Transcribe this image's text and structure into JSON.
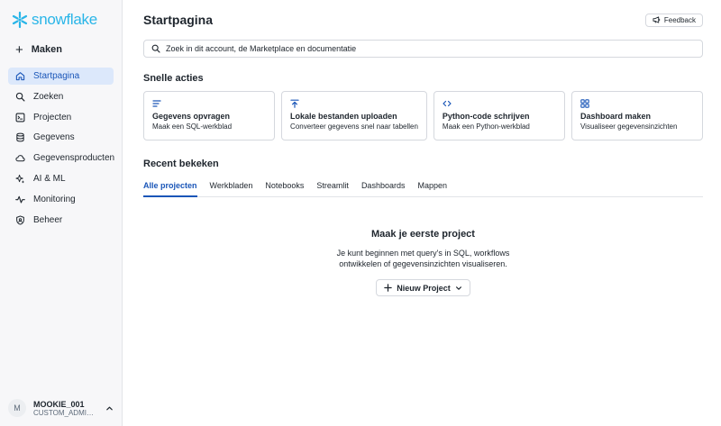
{
  "brand": {
    "name": "snowflake",
    "color": "#29b5e8"
  },
  "sidebar": {
    "create_label": "Maken",
    "items": [
      {
        "label": "Startpagina",
        "icon": "home-icon",
        "active": true
      },
      {
        "label": "Zoeken",
        "icon": "search-icon"
      },
      {
        "label": "Projecten",
        "icon": "projects-icon"
      },
      {
        "label": "Gegevens",
        "icon": "database-icon"
      },
      {
        "label": "Gegevensproducten",
        "icon": "cloud-icon"
      },
      {
        "label": "AI & ML",
        "icon": "sparkle-icon"
      },
      {
        "label": "Monitoring",
        "icon": "activity-icon"
      },
      {
        "label": "Beheer",
        "icon": "shield-icon"
      }
    ],
    "user": {
      "initial": "M",
      "name": "MOOKIE_001",
      "role": "CUSTOM_ADMIN_..."
    }
  },
  "header": {
    "title": "Startpagina",
    "feedback_label": "Feedback"
  },
  "search": {
    "placeholder": "Zoek in dit account, de Marketplace en documentatie"
  },
  "quick_actions": {
    "title": "Snelle acties",
    "cards": [
      {
        "title": "Gegevens opvragen",
        "subtitle": "Maak een SQL-werkblad",
        "icon": "query-lines-icon"
      },
      {
        "title": "Lokale bestanden uploaden",
        "subtitle": "Converteer gegevens snel naar tabellen",
        "icon": "upload-icon"
      },
      {
        "title": "Python-code schrijven",
        "subtitle": "Maak een Python-werkblad",
        "icon": "code-icon"
      },
      {
        "title": "Dashboard maken",
        "subtitle": "Visualiseer gegevensinzichten",
        "icon": "dashboard-icon"
      }
    ]
  },
  "recent": {
    "title": "Recent bekeken",
    "tabs": [
      "Alle projecten",
      "Werkbladen",
      "Notebooks",
      "Streamlit",
      "Dashboards",
      "Mappen"
    ],
    "active_tab": 0
  },
  "empty_state": {
    "title": "Maak je eerste project",
    "line1": "Je kunt beginnen met query's in SQL, workflows",
    "line2": "ontwikkelen of gegevensinzichten visualiseren.",
    "button_label": "Nieuw Project"
  },
  "colors": {
    "accent": "#1a56b8",
    "active_bg": "#dce8fb"
  }
}
